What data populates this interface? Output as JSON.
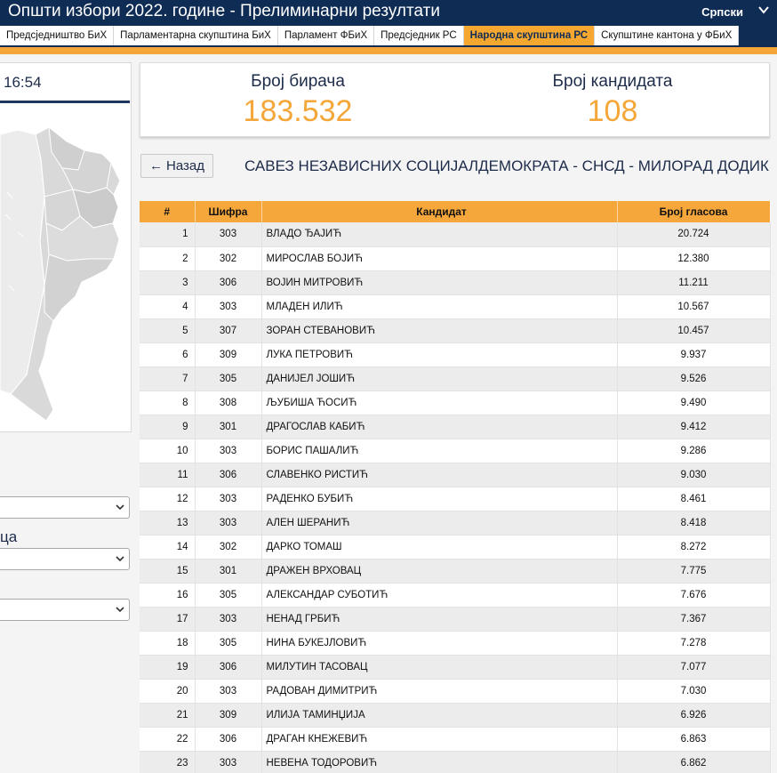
{
  "header": {
    "title": "Општи избори 2022. године - Прелиминарни резултати",
    "language": "Српски"
  },
  "tabs": [
    {
      "label": "Предсједништво БиХ",
      "active": false
    },
    {
      "label": "Парламентарна скупштина БиХ",
      "active": false
    },
    {
      "label": "Парламент ФБиХ",
      "active": false
    },
    {
      "label": "Предсједник РС",
      "active": false
    },
    {
      "label": "Народна скупштина РС",
      "active": true
    },
    {
      "label": "Скупштине кантона у ФБиХ",
      "active": false
    }
  ],
  "left": {
    "time": "16:54",
    "select2_label": "ца"
  },
  "stats": {
    "voters_label": "Број бирача",
    "voters_value": "183.532",
    "candidates_label": "Број кандидата",
    "candidates_value": "108"
  },
  "back_label": "Назад",
  "party_title": "САВЕЗ НЕЗАВИСНИХ СОЦИЈАЛДЕМОКРАТА - СНСД - МИЛОРАД ДОДИК",
  "table": {
    "headers": [
      "#",
      "Шифра",
      "Кандидат",
      "Број гласова"
    ],
    "rows": [
      [
        "1",
        "303",
        "ВЛАДО ЂАЈИЋ",
        "20.724"
      ],
      [
        "2",
        "302",
        "МИРОСЛАВ БОЈИЋ",
        "12.380"
      ],
      [
        "3",
        "306",
        "ВОЈИН МИТРОВИЋ",
        "11.211"
      ],
      [
        "4",
        "303",
        "МЛАДЕН ИЛИЋ",
        "10.567"
      ],
      [
        "5",
        "307",
        "ЗОРАН СТЕВАНОВИЋ",
        "10.457"
      ],
      [
        "6",
        "309",
        "ЛУКА ПЕТРОВИЋ",
        "9.937"
      ],
      [
        "7",
        "305",
        "ДАНИЈЕЛ ЈОШИЋ",
        "9.526"
      ],
      [
        "8",
        "308",
        "ЉУБИША ЋОСИЋ",
        "9.490"
      ],
      [
        "9",
        "301",
        "ДРАГОСЛАВ КАБИЋ",
        "9.412"
      ],
      [
        "10",
        "303",
        "БОРИС ПАШАЛИЋ",
        "9.286"
      ],
      [
        "11",
        "306",
        "СЛАВЕНКО РИСТИЋ",
        "9.030"
      ],
      [
        "12",
        "303",
        "РАДЕНКО БУБИЋ",
        "8.461"
      ],
      [
        "13",
        "303",
        "АЛЕН ШЕРАНИЋ",
        "8.418"
      ],
      [
        "14",
        "302",
        "ДАРКО ТОМАШ",
        "8.272"
      ],
      [
        "15",
        "301",
        "ДРАЖЕН ВРХОВАЦ",
        "7.775"
      ],
      [
        "16",
        "305",
        "АЛЕКСАНДАР СУБОТИЋ",
        "7.676"
      ],
      [
        "17",
        "303",
        "НЕНАД ГРБИЋ",
        "7.367"
      ],
      [
        "18",
        "305",
        "НИНА БУКЕЈЛОВИЋ",
        "7.278"
      ],
      [
        "19",
        "306",
        "МИЛУТИН ТАСОВАЦ",
        "7.077"
      ],
      [
        "20",
        "303",
        "РАДОВАН ДИМИТРИЋ",
        "7.030"
      ],
      [
        "21",
        "309",
        "ИЛИЈА ТАМИНЏИЈА",
        "6.926"
      ],
      [
        "22",
        "306",
        "ДРАГАН КНЕЖЕВИЋ",
        "6.863"
      ],
      [
        "23",
        "303",
        "НЕВЕНА ТОДОРОВИЋ",
        "6.862"
      ]
    ]
  },
  "colors": {
    "navy": "#0f2c55",
    "orange": "#f4a738",
    "row_alt": "#ececec"
  }
}
